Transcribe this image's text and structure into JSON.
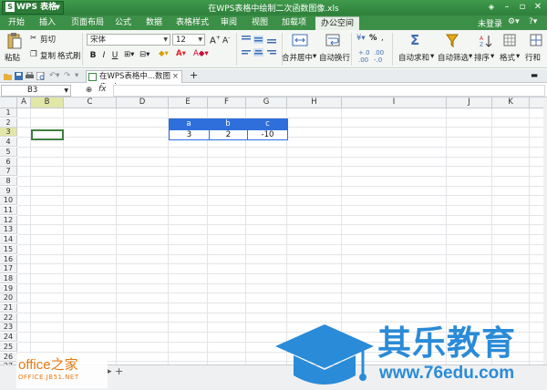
{
  "app": {
    "name": "WPS 表格",
    "logo_letter": "S"
  },
  "window": {
    "title": "在WPS表格中绘制二次函数图像.xls",
    "login": "未登录"
  },
  "menu": {
    "tabs": [
      {
        "label": "开始",
        "active": false
      },
      {
        "label": "插入",
        "active": false
      },
      {
        "label": "页面布局",
        "active": false
      },
      {
        "label": "公式",
        "active": false
      },
      {
        "label": "数据",
        "active": false
      },
      {
        "label": "表格样式",
        "active": false
      },
      {
        "label": "审阅",
        "active": false
      },
      {
        "label": "视图",
        "active": false
      },
      {
        "label": "加载项",
        "active": false
      },
      {
        "label": "办公空间",
        "active": true
      }
    ]
  },
  "ribbon": {
    "paste": "粘贴",
    "cut": "剪切",
    "copy": "复制",
    "format_painter": "格式刷",
    "font_name": "宋体",
    "font_size": "12",
    "bold": "B",
    "italic": "I",
    "underline": "U",
    "merge_center": "合并居中",
    "wrap_text": "自动换行",
    "percent": "%",
    "auto_sum": "自动求和",
    "auto_filter": "自动筛选",
    "sort": "排序",
    "format": "格式",
    "row_col": "行和"
  },
  "tab": {
    "doc_label": "在WPS表格中...数图像.xls",
    "add": "+"
  },
  "formula_bar": {
    "cell_ref": "B3",
    "fx": "fx",
    "value": ""
  },
  "grid": {
    "columns": [
      "A",
      "B",
      "C",
      "D",
      "E",
      "F",
      "G",
      "H",
      "I",
      "J",
      "K",
      "L"
    ],
    "rows": [
      "1",
      "2",
      "3",
      "4",
      "5",
      "6",
      "7",
      "8",
      "9",
      "10",
      "11",
      "12",
      "13",
      "14",
      "15",
      "16",
      "17",
      "18",
      "19",
      "20",
      "21",
      "22",
      "23",
      "24",
      "25",
      "26",
      "27"
    ],
    "selected_col": "B",
    "selected_row": "3",
    "table_header": [
      "a",
      "b",
      "c"
    ],
    "table_values": [
      "3",
      "2",
      "-10"
    ]
  },
  "sheetbar": {
    "add": "+"
  },
  "watermarks": {
    "left_brand": "office之家",
    "left_url": "OFFICE.JB51.NET",
    "right_brand": "其乐教育",
    "right_url": "www.76edu.com"
  },
  "colors": {
    "title_green": "#3f9a4c",
    "table_header_blue": "#2f6fdc",
    "watermark_blue": "#2a8bd8",
    "watermark_orange": "#e57a12"
  }
}
